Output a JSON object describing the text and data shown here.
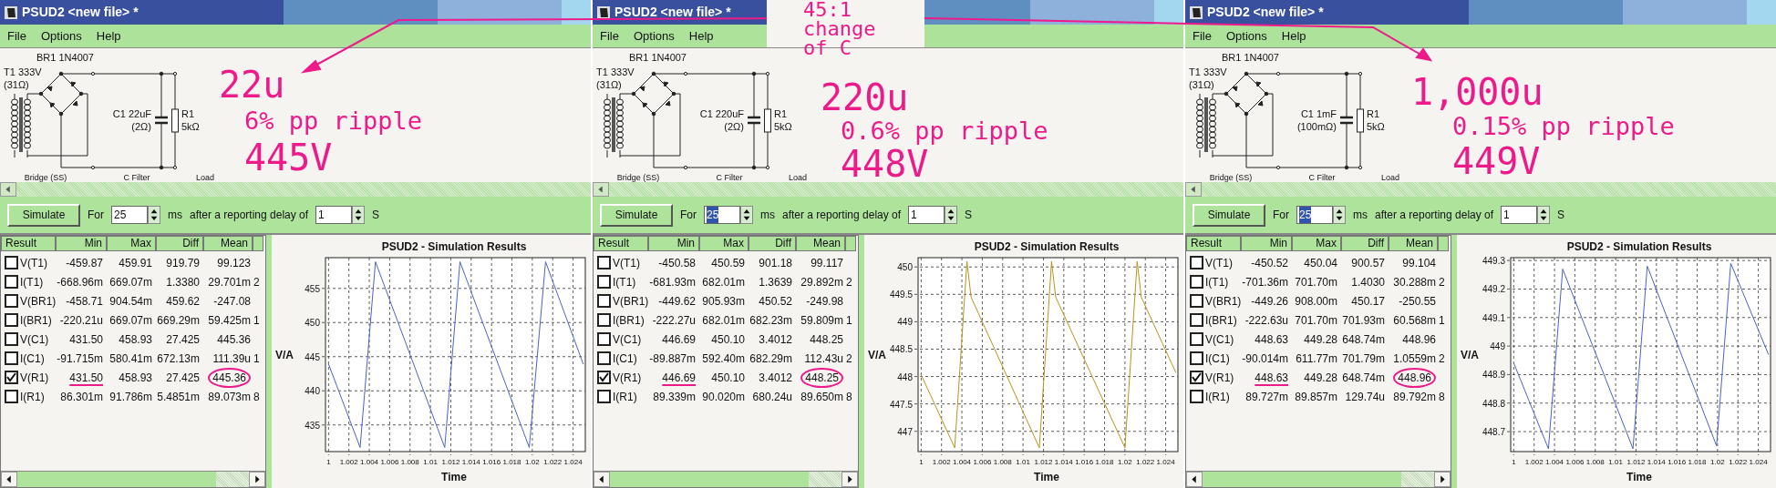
{
  "annotation": {
    "note": "45:1 change of C"
  },
  "windows": [
    {
      "title": "PSUD2 <new file> *",
      "menu": [
        "File",
        "Options",
        "Help"
      ],
      "schematic": {
        "bridge_label": "BR1 1N4007",
        "transformer_label": "T1 333V",
        "transformer_resistance": "(31Ω)",
        "capacitor_label": "C1 22uF",
        "capacitor_resistance": "(2Ω)",
        "resistor_label": "R1",
        "resistor_value": "5kΩ",
        "sections": [
          "Bridge (SS)",
          "C Filter",
          "Load"
        ]
      },
      "callout": {
        "capacitance": "22u",
        "ripple": "6% pp ripple",
        "voltage": "445V"
      },
      "toolbar": {
        "button": "Simulate",
        "for_label": "For",
        "duration": {
          "value": "25",
          "highlighted": false
        },
        "duration_unit": "ms",
        "delay_label": "after a reporting delay of",
        "delay": {
          "value": "1"
        },
        "delay_unit": "S"
      },
      "table": {
        "columns": [
          "Result",
          "Min",
          "Max",
          "Diff",
          "Mean"
        ],
        "rows": [
          {
            "checked": false,
            "result": "V(T1)",
            "min": "-459.87",
            "max": "459.91",
            "diff": "919.79",
            "mean": "99.123",
            "marked": false
          },
          {
            "checked": false,
            "result": "I(T1)",
            "min": "-668.96m",
            "max": "669.07m",
            "diff": "1.3380",
            "mean": "29.701m",
            "column_6": "2",
            "marked": false
          },
          {
            "checked": false,
            "result": "V(BR1)",
            "min": "-458.71",
            "max": "904.54m",
            "diff": "459.62",
            "mean": "-247.08",
            "marked": false
          },
          {
            "checked": false,
            "result": "I(BR1)",
            "min": "-220.21u",
            "max": "669.07m",
            "diff": "669.29m",
            "mean": "59.425m",
            "column_6": "1",
            "marked": false
          },
          {
            "checked": false,
            "result": "V(C1)",
            "min": "431.50",
            "max": "458.93",
            "diff": "27.425",
            "mean": "445.36",
            "marked": false
          },
          {
            "checked": false,
            "result": "I(C1)",
            "min": "-91.715m",
            "max": "580.41m",
            "diff": "672.13m",
            "mean": "111.39u",
            "column_6": "1",
            "marked": false
          },
          {
            "checked": true,
            "result": "V(R1)",
            "min": "431.50",
            "max": "458.93",
            "diff": "27.425",
            "mean": "445.36",
            "marked": true
          },
          {
            "checked": false,
            "result": "I(R1)",
            "min": "86.301m",
            "max": "91.786m",
            "diff": "5.4851m",
            "mean": "89.073m",
            "column_6": "8",
            "marked": false
          }
        ]
      },
      "chart": {
        "chart_data": {
          "type": "line",
          "title": "PSUD2 - Simulation Results",
          "xlabel": "Time",
          "ylabel": "V/A",
          "xlim": [
            0.9997,
            1.0252
          ],
          "ylim": [
            431.1,
            459.5
          ],
          "xticks": [
            1,
            1.002,
            1.004,
            1.006,
            1.008,
            1.01,
            1.012,
            1.014,
            1.016,
            1.018,
            1.02,
            1.022,
            1.024
          ],
          "yticks": [
            435,
            440,
            445,
            450,
            455
          ],
          "x": [
            1,
            1.0031,
            1.0046,
            1.0114,
            1.0129,
            1.0197,
            1.0213,
            1.025
          ],
          "grid": true,
          "series": [
            {
              "color": "#4a64c8",
              "values": [
                443.9,
                431.7,
                458.9,
                431.7,
                458.9,
                431.7,
                458.9,
                443.9
              ]
            }
          ]
        }
      }
    },
    {
      "title": "PSUD2 <new file> *",
      "menu": [
        "File",
        "Options",
        "Help"
      ],
      "schematic": {
        "bridge_label": "BR1 1N4007",
        "transformer_label": "T1 333V",
        "transformer_resistance": "(31Ω)",
        "capacitor_label": "C1 220uF",
        "capacitor_resistance": "(2Ω)",
        "resistor_label": "R1",
        "resistor_value": "5kΩ",
        "sections": [
          "Bridge (SS)",
          "C Filter",
          "Load"
        ]
      },
      "callout": {
        "capacitance": "220u",
        "ripple": "0.6% pp ripple",
        "voltage": "448V"
      },
      "toolbar": {
        "button": "Simulate",
        "for_label": "For",
        "duration": {
          "value": "25",
          "highlighted": true
        },
        "duration_unit": "ms",
        "delay_label": "after a reporting delay of",
        "delay": {
          "value": "1"
        },
        "delay_unit": "S"
      },
      "table": {
        "columns": [
          "Result",
          "Min",
          "Max",
          "Diff",
          "Mean"
        ],
        "rows": [
          {
            "checked": false,
            "result": "V(T1)",
            "min": "-450.58",
            "max": "450.59",
            "diff": "901.18",
            "mean": "99.117",
            "marked": false
          },
          {
            "checked": false,
            "result": "I(T1)",
            "min": "-681.93m",
            "max": "682.01m",
            "diff": "1.3639",
            "mean": "29.892m",
            "column_6": "2",
            "marked": false
          },
          {
            "checked": false,
            "result": "V(BR1)",
            "min": "-449.62",
            "max": "905.93m",
            "diff": "450.52",
            "mean": "-249.98",
            "marked": false
          },
          {
            "checked": false,
            "result": "I(BR1)",
            "min": "-222.27u",
            "max": "682.01m",
            "diff": "682.23m",
            "mean": "59.809m",
            "column_6": "1",
            "marked": false
          },
          {
            "checked": false,
            "result": "V(C1)",
            "min": "446.69",
            "max": "450.10",
            "diff": "3.4012",
            "mean": "448.25",
            "marked": false
          },
          {
            "checked": false,
            "result": "I(C1)",
            "min": "-89.887m",
            "max": "592.40m",
            "diff": "682.29m",
            "mean": "112.43u",
            "column_6": "2",
            "marked": false
          },
          {
            "checked": true,
            "result": "V(R1)",
            "min": "446.69",
            "max": "450.10",
            "diff": "3.4012",
            "mean": "448.25",
            "marked": true
          },
          {
            "checked": false,
            "result": "I(R1)",
            "min": "89.339m",
            "max": "90.020m",
            "diff": "680.24u",
            "mean": "89.650m",
            "column_6": "8",
            "marked": false
          }
        ]
      },
      "chart": {
        "chart_data": {
          "type": "line",
          "title": "PSUD2 - Simulation Results",
          "xlabel": "Time",
          "ylabel": "V/A",
          "xlim": [
            0.9997,
            1.0252
          ],
          "ylim": [
            446.63,
            450.17
          ],
          "xticks": [
            1,
            1.002,
            1.004,
            1.006,
            1.008,
            1.01,
            1.012,
            1.014,
            1.016,
            1.018,
            1.02,
            1.022,
            1.024
          ],
          "yticks": [
            447,
            447.5,
            448,
            448.5,
            449,
            449.5,
            450
          ],
          "x": [
            1,
            1.0033,
            1.0045,
            1.0049,
            1.0116,
            1.0128,
            1.0132,
            1.02,
            1.0212,
            1.0216,
            1.025
          ],
          "grid": true,
          "series": [
            {
              "color": "#b8941c",
              "values": [
                448.03,
                446.7,
                450.1,
                449.45,
                446.7,
                450.1,
                449.45,
                446.7,
                450.1,
                449.45,
                448.07
              ]
            }
          ]
        }
      }
    },
    {
      "title": "PSUD2 <new file> *",
      "menu": [
        "File",
        "Options",
        "Help"
      ],
      "schematic": {
        "bridge_label": "BR1 1N4007",
        "transformer_label": "T1 333V",
        "transformer_resistance": "(31Ω)",
        "capacitor_label": "C1 1mF",
        "capacitor_resistance": "(100mΩ)",
        "resistor_label": "R1",
        "resistor_value": "5kΩ",
        "sections": [
          "Bridge (SS)",
          "C Filter",
          "Load"
        ]
      },
      "callout": {
        "capacitance": "1,000u",
        "ripple": "0.15% pp ripple",
        "voltage": "449V"
      },
      "toolbar": {
        "button": "Simulate",
        "for_label": "For",
        "duration": {
          "value": "25",
          "highlighted": true
        },
        "duration_unit": "ms",
        "delay_label": "after a reporting delay of",
        "delay": {
          "value": "1"
        },
        "delay_unit": "S"
      },
      "table": {
        "columns": [
          "Result",
          "Min",
          "Max",
          "Diff",
          "Mean"
        ],
        "rows": [
          {
            "checked": false,
            "result": "V(T1)",
            "min": "-450.52",
            "max": "450.04",
            "diff": "900.57",
            "mean": "99.104",
            "marked": false
          },
          {
            "checked": false,
            "result": "I(T1)",
            "min": "-701.36m",
            "max": "701.70m",
            "diff": "1.4030",
            "mean": "30.288m",
            "column_6": "2",
            "marked": false
          },
          {
            "checked": false,
            "result": "V(BR1)",
            "min": "-449.26",
            "max": "908.00m",
            "diff": "450.17",
            "mean": "-250.55",
            "marked": false
          },
          {
            "checked": false,
            "result": "I(BR1)",
            "min": "-222.63u",
            "max": "701.70m",
            "diff": "701.93m",
            "mean": "60.568m",
            "column_6": "1",
            "marked": false
          },
          {
            "checked": false,
            "result": "V(C1)",
            "min": "448.63",
            "max": "449.28",
            "diff": "648.74m",
            "mean": "448.96",
            "marked": false
          },
          {
            "checked": false,
            "result": "I(C1)",
            "min": "-90.014m",
            "max": "611.77m",
            "diff": "701.79m",
            "mean": "1.0559m",
            "column_6": "2",
            "marked": false
          },
          {
            "checked": true,
            "result": "V(R1)",
            "min": "448.63",
            "max": "449.28",
            "diff": "648.74m",
            "mean": "448.96",
            "marked": true
          },
          {
            "checked": false,
            "result": "I(R1)",
            "min": "89.727m",
            "max": "89.857m",
            "diff": "129.74u",
            "mean": "89.792m",
            "column_6": "8",
            "marked": false
          }
        ]
      },
      "chart": {
        "chart_data": {
          "type": "line",
          "title": "PSUD2 - Simulation Results",
          "xlabel": "Time",
          "ylabel": "V/A",
          "xlim": [
            0.9997,
            1.0252
          ],
          "ylim": [
            448.63,
            449.31
          ],
          "xticks": [
            1,
            1.002,
            1.004,
            1.006,
            1.008,
            1.01,
            1.012,
            1.014,
            1.016,
            1.018,
            1.02,
            1.022,
            1.024
          ],
          "yticks": [
            448.7,
            448.8,
            448.9,
            449,
            449.1,
            449.2,
            449.3
          ],
          "x": [
            1,
            1.0034,
            1.0048,
            1.0117,
            1.0131,
            1.0199,
            1.0213,
            1.025
          ],
          "grid": true,
          "series": [
            {
              "color": "#4a64c8",
              "values": [
                448.94,
                448.64,
                449.27,
                448.64,
                449.28,
                448.65,
                449.29,
                448.97
              ]
            }
          ]
        }
      }
    }
  ]
}
